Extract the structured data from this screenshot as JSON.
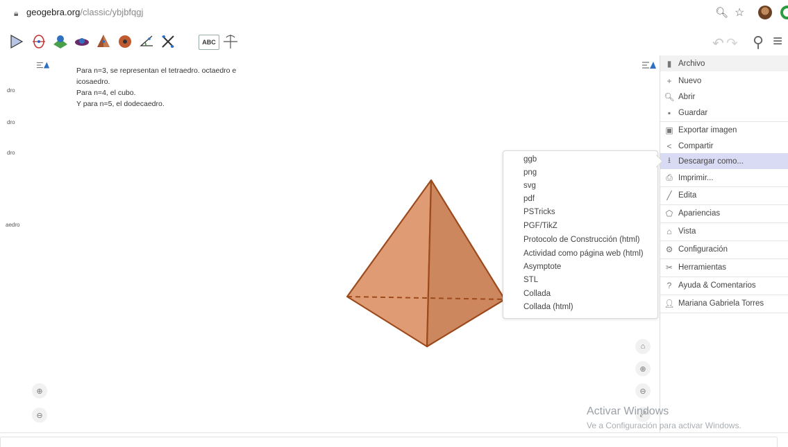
{
  "browser": {
    "url_host": "geogebra.org",
    "url_path": "/classic/ybjbfqgj"
  },
  "toolbar": {
    "tools": [
      "move-tool",
      "point-tool",
      "plane-tool",
      "intersect-tool",
      "pyramid-tool",
      "sphere-tool",
      "angle-tool",
      "reflect-tool",
      "text-tool",
      "rotate-view-tool"
    ],
    "abc_label": "ABC"
  },
  "algebra": {
    "items": [
      "dro",
      "dro",
      "dro",
      "aedro"
    ]
  },
  "graphics": {
    "note_lines": [
      "Para n=3, se representan el tetraedro. octaedro e",
      "icosaedro.",
      "Para n=4, el cubo.",
      "Y para n=5, el dodecaedro."
    ],
    "pyramid_fill": "#d98a5a",
    "pyramid_edge": "#9c4a1c"
  },
  "menu": {
    "header": "Archivo",
    "items": [
      {
        "icon": "+",
        "label": "Nuevo"
      },
      {
        "icon": "🔍︎",
        "label": "Abrir"
      },
      {
        "icon": "▪",
        "label": "Guardar"
      },
      {
        "icon": "▣",
        "label": "Exportar imagen"
      },
      {
        "icon": "<",
        "label": "Compartir"
      },
      {
        "icon": "⭳",
        "label": "Descargar como..."
      },
      {
        "icon": "⎙",
        "label": "Imprimir..."
      },
      {
        "icon": "╱",
        "label": "Edita"
      },
      {
        "icon": "⬠",
        "label": "Apariencias"
      },
      {
        "icon": "⌂",
        "label": "Vista"
      },
      {
        "icon": "⚙",
        "label": "Configuración"
      },
      {
        "icon": "✂",
        "label": "Herramientas"
      },
      {
        "icon": "?",
        "label": "Ayuda & Comentarios"
      },
      {
        "icon": "👤︎",
        "label": "Mariana Gabriela Torres"
      }
    ],
    "selected_label": "Descargar como..."
  },
  "submenu": {
    "items": [
      "ggb",
      "png",
      "svg",
      "pdf",
      "PSTricks",
      "PGF/TikZ",
      "Protocolo de Construcción (html)",
      "Actividad como página web (html)",
      "Asymptote",
      "STL",
      "Collada",
      "Collada (html)"
    ]
  },
  "watermark": {
    "line1": "Activar Windows",
    "line2": "Ve a Configuración para activar Windows."
  },
  "colors": {
    "accent": "#d9dbf5",
    "menu_header": "#f2f2f2"
  }
}
